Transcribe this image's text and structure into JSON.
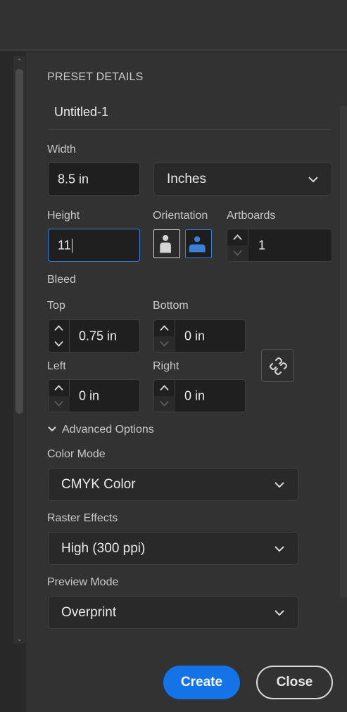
{
  "preset": {
    "section_title": "PRESET DETAILS",
    "name": "Untitled-1"
  },
  "width": {
    "label": "Width",
    "value": "8.5 in",
    "units_selected": "Inches"
  },
  "height": {
    "label": "Height",
    "value": "11"
  },
  "orientation": {
    "label": "Orientation",
    "selected": "landscape",
    "options_icons": [
      "portrait-icon",
      "landscape-icon"
    ]
  },
  "artboards": {
    "label": "Artboards",
    "value": "1"
  },
  "bleed": {
    "label": "Bleed",
    "top_label": "Top",
    "top_value": "0.75 in",
    "bottom_label": "Bottom",
    "bottom_value": "0 in",
    "left_label": "Left",
    "left_value": "0 in",
    "right_label": "Right",
    "right_value": "0 in",
    "link_icon": "unlink-icon"
  },
  "advanced": {
    "toggle_label": "Advanced Options",
    "color_mode_label": "Color Mode",
    "color_mode_value": "CMYK Color",
    "raster_label": "Raster Effects",
    "raster_value": "High (300 ppi)",
    "preview_label": "Preview Mode",
    "preview_value": "Overprint"
  },
  "actions": {
    "create_label": "Create",
    "close_label": "Close"
  },
  "colors": {
    "accent": "#1473e6",
    "focus_border": "#3a7fd9",
    "panel_bg": "#323232",
    "field_bg": "#1f1f1f"
  }
}
